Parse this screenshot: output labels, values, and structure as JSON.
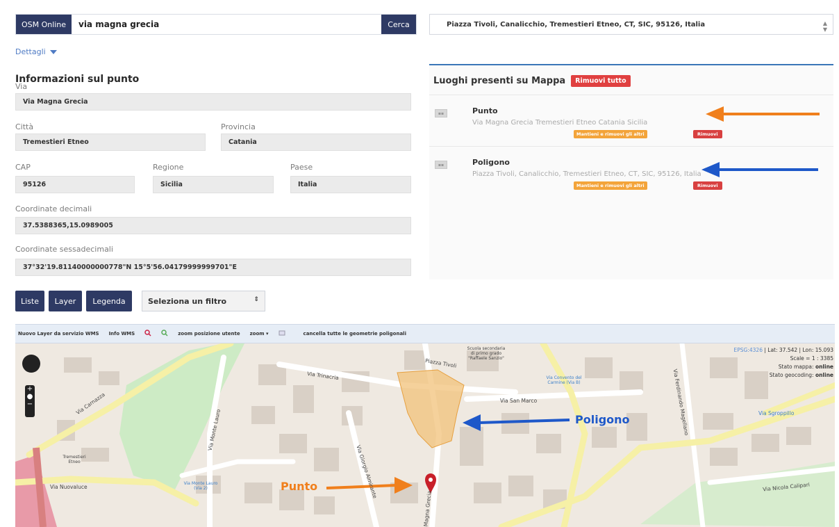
{
  "search": {
    "source_label": "OSM Online",
    "query": "via magna grecia",
    "button_label": "Cerca"
  },
  "details_toggle": "Dettagli",
  "info": {
    "title": "Informazioni sul punto",
    "via_label": "Via",
    "via_value": "Via Magna Grecia",
    "citta_label": "Città",
    "citta_value": "Tremestieri Etneo",
    "provincia_label": "Provincia",
    "provincia_value": "Catania",
    "cap_label": "CAP",
    "cap_value": "95126",
    "regione_label": "Regione",
    "regione_value": "Sicilia",
    "paese_label": "Paese",
    "paese_value": "Italia",
    "coord_dec_label": "Coordinate decimali",
    "coord_dec_value": "37.5388365,15.0989005",
    "coord_sex_label": "Coordinate sessadecimali",
    "coord_sex_value": "37°32'19.81140000000778\"N 15°5'56.04179999999701\"E"
  },
  "address_select": {
    "value": "Piazza Tivoli, Canalicchio, Tremestieri Etneo, CT, SIC, 95126, Italia"
  },
  "places": {
    "title": "Luoghi presenti su Mappa",
    "remove_all_label": "Rimuovi tutto",
    "items": [
      {
        "title": "Punto",
        "address": "Via Magna Grecia Tremestieri Etneo Catania Sicilia",
        "keep_label": "Mantieni e rimuovi gli altri",
        "remove_label": "Rimuovi",
        "arrow_color": "#f07f1c"
      },
      {
        "title": "Poligono",
        "address": "Piazza Tivoli, Canalicchio, Tremestieri Etneo, CT, SIC, 95126, Italia",
        "keep_label": "Mantieni e rimuovi gli altri",
        "remove_label": "Rimuovi",
        "arrow_color": "#1e58c9"
      }
    ]
  },
  "toolbar": {
    "liste_label": "Liste",
    "layer_label": "Layer",
    "legenda_label": "Legenda",
    "filter_value": "Seleziona un filtro"
  },
  "map_toolbar": {
    "wms_label": "Nuovo Layer da servizio WMS",
    "info_wms_label": "Info WMS",
    "zoom_user_label": "zoom posizione utente",
    "zoom_label": "zoom ▾",
    "clear_label": "cancella tutte le geometrie poligonali"
  },
  "map": {
    "epsg": "EPSG:4326",
    "coords": "Lat: 37.542 | Lon: 15.093",
    "scale": "Scale = 1 : 3385",
    "state_map_label": "Stato mappa:",
    "state_map_value": "online",
    "state_geo_label": "Stato geocoding:",
    "state_geo_value": "online",
    "annotation_poligono": "Poligono",
    "annotation_punto": "Punto",
    "streets": {
      "trinacria": "Via Trinacria",
      "san_marco": "Via San Marco",
      "carnazza": "Via Carnazza",
      "monte_lauro": "Via Monte Lauro",
      "nuovaluce": "Via Nuovaluce",
      "giorgio_almirante": "Via Giorgio Almirante",
      "magna_grecia": "Via Magna Grecia",
      "nicola_calipari": "Via Nicola Calipari",
      "ferdinando_magellano": "Via Ferdinando Magellano",
      "piazza_tivoli": "Piazza Tivoli",
      "sgroppillo": "Via Sgroppillo"
    },
    "pois": {
      "school": "Scuola secondaria di primo grado \"Raffaele Sanzio\"",
      "convent": "Via Convento del Carmine (Via B)",
      "tremestieri": "Tremestieri Etneo",
      "monte_lauro_poi": "Via Monte Lauro (Via 2)"
    },
    "colors": {
      "polygon_fill": "#f2c27a",
      "orange_arrow": "#f07f1c",
      "blue_arrow": "#1e58c9",
      "marker": "#c8202a"
    }
  }
}
